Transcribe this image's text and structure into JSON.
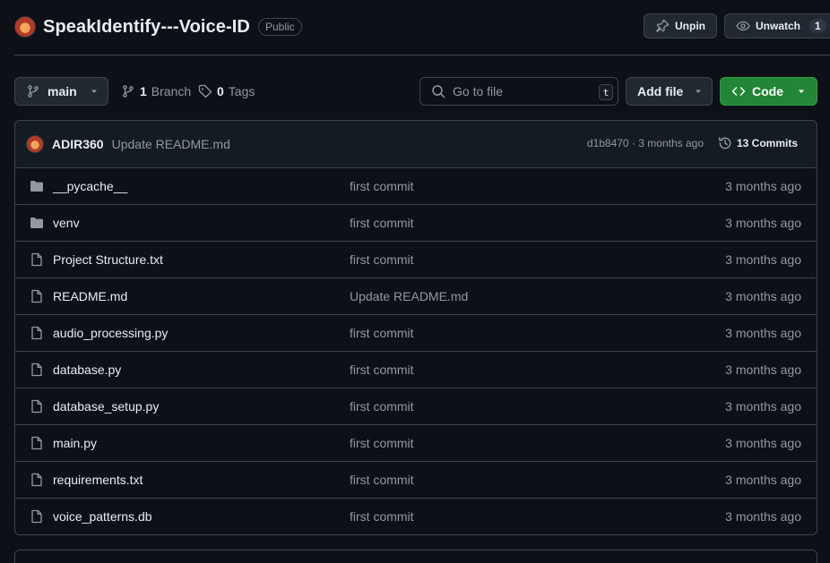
{
  "repo": {
    "name": "SpeakIdentify---Voice-ID",
    "visibility": "Public"
  },
  "actions": {
    "unpin_label": "Unpin",
    "unwatch_label": "Unwatch",
    "watch_count": "1"
  },
  "toolbar": {
    "branch": "main",
    "branches_count": "1",
    "branches_label": "Branch",
    "tags_count": "0",
    "tags_label": "Tags",
    "search_placeholder": "Go to file",
    "search_shortcut": "t",
    "add_file_label": "Add file",
    "code_label": "Code"
  },
  "latest_commit": {
    "author": "ADIR360",
    "message": "Update README.md",
    "hash": "d1b8470",
    "time": "3 months ago",
    "meta_text": "d1b8470 · 3 months ago",
    "commits_label": "13 Commits"
  },
  "files": [
    {
      "name": "__pycache__",
      "type": "folder",
      "message": "first commit",
      "age": "3 months ago"
    },
    {
      "name": "venv",
      "type": "folder",
      "message": "first commit",
      "age": "3 months ago"
    },
    {
      "name": "Project Structure.txt",
      "type": "file",
      "message": "first commit",
      "age": "3 months ago"
    },
    {
      "name": "README.md",
      "type": "file",
      "message": "Update README.md",
      "age": "3 months ago"
    },
    {
      "name": "audio_processing.py",
      "type": "file",
      "message": "first commit",
      "age": "3 months ago"
    },
    {
      "name": "database.py",
      "type": "file",
      "message": "first commit",
      "age": "3 months ago"
    },
    {
      "name": "database_setup.py",
      "type": "file",
      "message": "first commit",
      "age": "3 months ago"
    },
    {
      "name": "main.py",
      "type": "file",
      "message": "first commit",
      "age": "3 months ago"
    },
    {
      "name": "requirements.txt",
      "type": "file",
      "message": "first commit",
      "age": "3 months ago"
    },
    {
      "name": "voice_patterns.db",
      "type": "file",
      "message": "first commit",
      "age": "3 months ago"
    }
  ],
  "colors": {
    "background": "#0d1117",
    "border": "#3d444d",
    "muted_text": "#9198a1",
    "code_button": "#238636"
  }
}
